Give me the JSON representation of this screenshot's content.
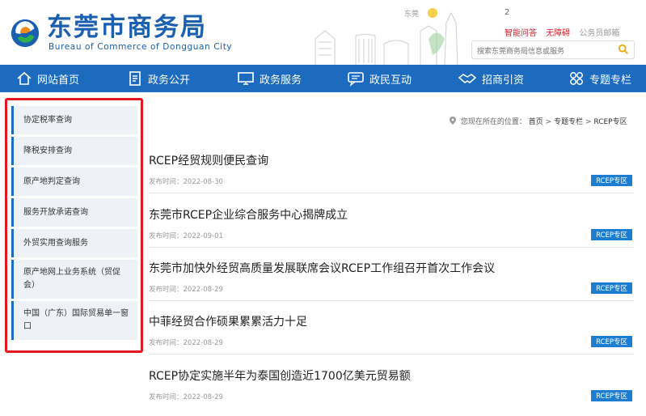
{
  "header": {
    "logo_cn": "东莞市商务局",
    "logo_en": "Bureau of Commerce of Dongguan City",
    "city_label": "东莞",
    "weather_num": "2",
    "link_smart_qa": "智能问答",
    "link_accessible": "无障碍",
    "link_email": "公务员邮箱",
    "search_placeholder": "搜索东莞商务局信息或服务",
    "colors": {
      "brand": "#1a5fb0",
      "nav": "#1d6bbf",
      "alert": "#d4202c"
    }
  },
  "nav": {
    "items": [
      {
        "label": "网站首页",
        "icon": "home-icon"
      },
      {
        "label": "政务公开",
        "icon": "document-icon"
      },
      {
        "label": "政务服务",
        "icon": "monitor-icon"
      },
      {
        "label": "政民互动",
        "icon": "chat-icon"
      },
      {
        "label": "招商引资",
        "icon": "handshake-icon"
      },
      {
        "label": "专题专栏",
        "icon": "grid-icon"
      }
    ]
  },
  "sidebar": {
    "items": [
      {
        "label": "协定税率查询"
      },
      {
        "label": "降税安排查询"
      },
      {
        "label": "原产地判定查询"
      },
      {
        "label": "服务开放承诺查询"
      },
      {
        "label": "外贸实用查询服务"
      },
      {
        "label": "原产地网上业务系统（贸促会）"
      },
      {
        "label": "中国（广东）国际贸易单一窗口"
      }
    ]
  },
  "breadcrumb": {
    "prefix": "您现在所在的位置：",
    "home": "首页",
    "sep1": ">",
    "section": "专题专栏",
    "sep2": ">",
    "current": "RCEP专区"
  },
  "articles": [
    {
      "title": "RCEP经贸规则便民查询",
      "date": "发布时间：2022-08-30",
      "tag": "RCEP专区"
    },
    {
      "title": "东莞市RCEP企业综合服务中心揭牌成立",
      "date": "发布时间：2022-09-01",
      "tag": "RCEP专区"
    },
    {
      "title": "东莞市加快外经贸高质量发展联席会议RCEP工作组召开首次工作会议",
      "date": "发布时间：2022-08-29",
      "tag": "RCEP专区"
    },
    {
      "title": "中菲经贸合作硕果累累活力十足",
      "date": "发布时间：2022-08-29",
      "tag": "RCEP专区"
    },
    {
      "title": "RCEP协定实施半年为泰国创造近1700亿美元贸易额",
      "date": "发布时间：2022-08-29",
      "tag": "RCEP专区"
    }
  ]
}
